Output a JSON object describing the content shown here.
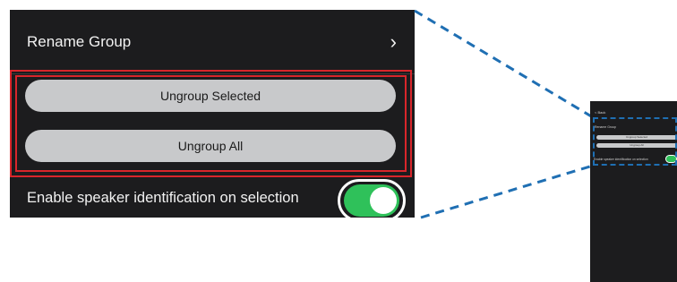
{
  "zoom": {
    "rename_label": "Rename Group",
    "chevron_glyph": "›",
    "ungroup_selected_label": "Ungroup Selected",
    "ungroup_all_label": "Ungroup All",
    "speaker_label": "Enable speaker identification on selection",
    "speaker_toggle_on": true
  },
  "phone": {
    "back_label": "< Back",
    "rename_label": "Rename Group",
    "ungroup_selected_label": "Ungroup Selected",
    "ungroup_all_label": "Ungroup All",
    "speaker_label": "Enable speaker identification on selection"
  },
  "colors": {
    "panel_bg": "#1c1c1e",
    "button_bg": "#c8c9cb",
    "highlight_red": "#d8262b",
    "toggle_green": "#2fc15a",
    "connector_blue": "#1f6fb3"
  }
}
